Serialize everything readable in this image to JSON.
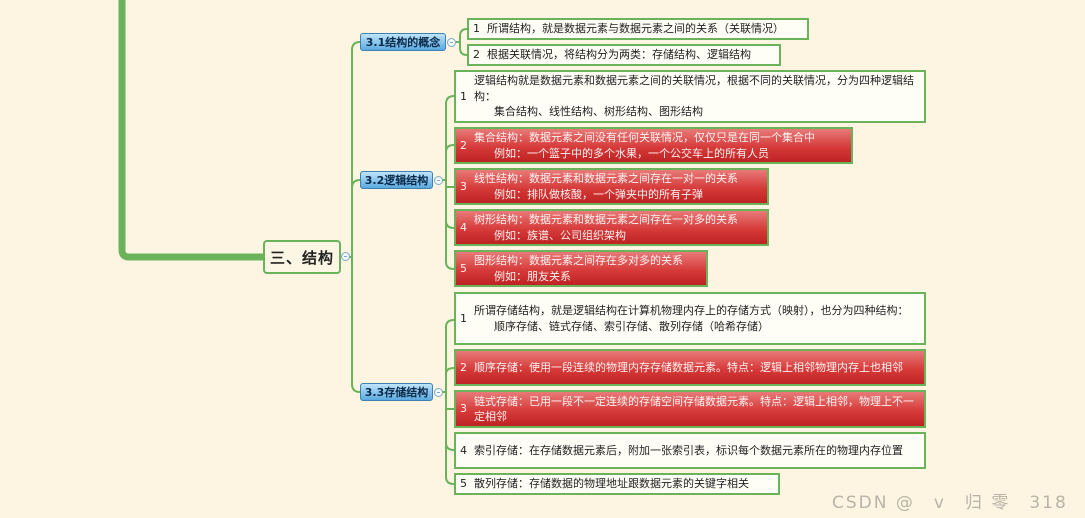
{
  "root": {
    "label": "三、结构"
  },
  "sections": [
    {
      "label": "3.1结构的概念"
    },
    {
      "label": "3.2逻辑结构"
    },
    {
      "label": "3.3存储结构"
    }
  ],
  "s31": [
    {
      "num": "1",
      "line1": "所谓结构，就是数据元素与数据元素之间的关系（关联情况）"
    },
    {
      "num": "2",
      "line1": "根据关联情况，将结构分为两类：存储结构、逻辑结构"
    }
  ],
  "s32": [
    {
      "num": "1",
      "line1": "逻辑结构就是数据元素和数据元素之间的关联情况，根据不同的关联情况，分为四种逻辑结构：",
      "line2": "集合结构、线性结构、树形结构、图形结构"
    },
    {
      "num": "2",
      "line1": "集合结构：数据元素之间没有任何关联情况，仅仅只是在同一个集合中",
      "line2": "例如：一个篮子中的多个水果，一个公交车上的所有人员"
    },
    {
      "num": "3",
      "line1": "线性结构：数据元素和数据元素之间存在一对一的关系",
      "line2": "例如：排队做核酸，一个弹夹中的所有子弹"
    },
    {
      "num": "4",
      "line1": "树形结构：数据元素和数据元素之间存在一对多的关系",
      "line2": "例如：族谱、公司组织架构"
    },
    {
      "num": "5",
      "line1": "图形结构：数据元素之间存在多对多的关系",
      "line2": "例如：朋友关系"
    }
  ],
  "s33": [
    {
      "num": "1",
      "line1": "所谓存储结构，就是逻辑结构在计算机物理内存上的存储方式（映射），也分为四种结构：",
      "line2": "顺序存储、链式存储、索引存储、散列存储（哈希存储）"
    },
    {
      "num": "2",
      "line1": "顺序存储：使用一段连续的物理内存存储数据元素。特点：逻辑上相邻物理内存上也相邻"
    },
    {
      "num": "3",
      "line1": "链式存储：已用一段不一定连续的存储空间存储数据元素。特点：逻辑上相邻，物理上不一定相邻"
    },
    {
      "num": "4",
      "line1": "索引存储：在存储数据元素后，附加一张索引表，标识每个数据元素所在的物理内存位置"
    },
    {
      "num": "5",
      "line1": "散列存储：存储数据的物理地址跟数据元素的关键字相关"
    }
  ],
  "watermark": "CSDN @　v　归 零　318",
  "colors": {
    "background": "#fdf4e1",
    "branch": "#6ab35b",
    "section": "#5aaae0",
    "highlight": "#d63b3a"
  }
}
